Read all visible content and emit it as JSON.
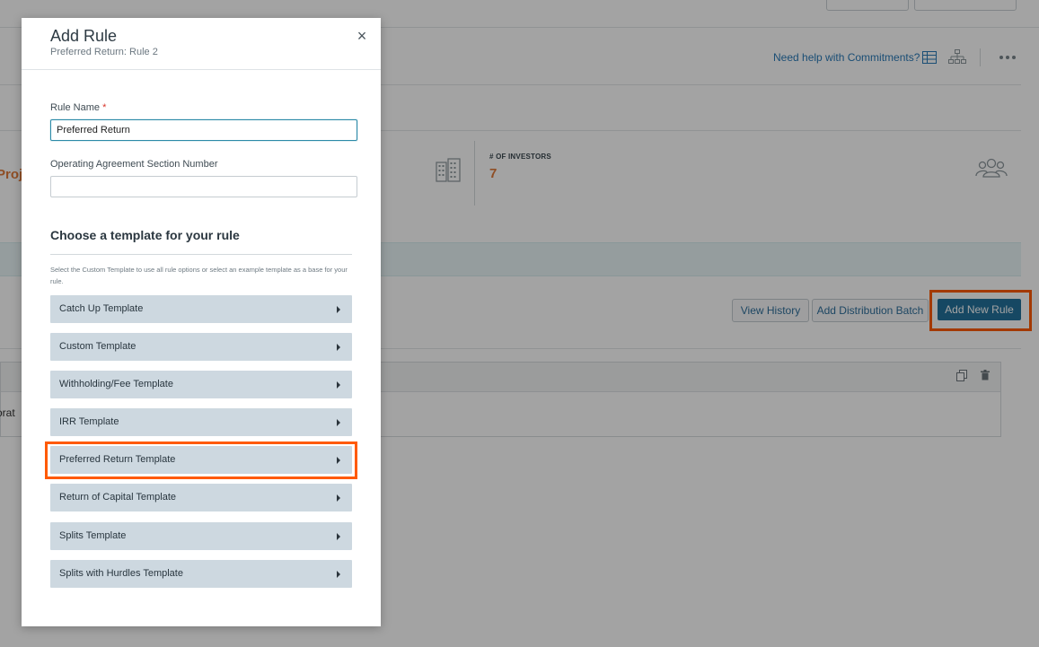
{
  "background": {
    "help_link": "Need help with Commitments?",
    "metric_label": "# OF INVESTORS",
    "metric_value": "7",
    "partial_title": "Proj",
    "buttons": {
      "view_history": "View History",
      "add_distribution_batch": "Add Distribution Batch",
      "add_new_rule": "Add New Rule"
    },
    "row_partial_text": "orat"
  },
  "modal": {
    "title": "Add Rule",
    "subtitle": "Preferred Return: Rule 2",
    "close_glyph": "×",
    "rule_name_label": "Rule Name",
    "required_mark": "*",
    "rule_name_value": "Preferred Return",
    "section_number_label": "Operating Agreement Section Number",
    "section_number_value": "",
    "template_heading": "Choose a template for your rule",
    "template_helper": "Select the Custom Template to use all rule options or select an example template as a base for your rule.",
    "templates": [
      {
        "label": "Catch Up Template"
      },
      {
        "label": "Custom Template"
      },
      {
        "label": "Withholding/Fee Template"
      },
      {
        "label": "IRR Template"
      },
      {
        "label": "Preferred Return Template",
        "highlighted": true
      },
      {
        "label": "Return of Capital Template"
      },
      {
        "label": "Splits Template"
      },
      {
        "label": "Splits with Hurdles Template"
      }
    ]
  },
  "colors": {
    "accent_highlight": "#ff5a00",
    "primary_button": "#23719b",
    "template_item_bg": "#cdd8e0",
    "metric_orange": "#e07a3a",
    "link_blue": "#2a7ab8"
  }
}
